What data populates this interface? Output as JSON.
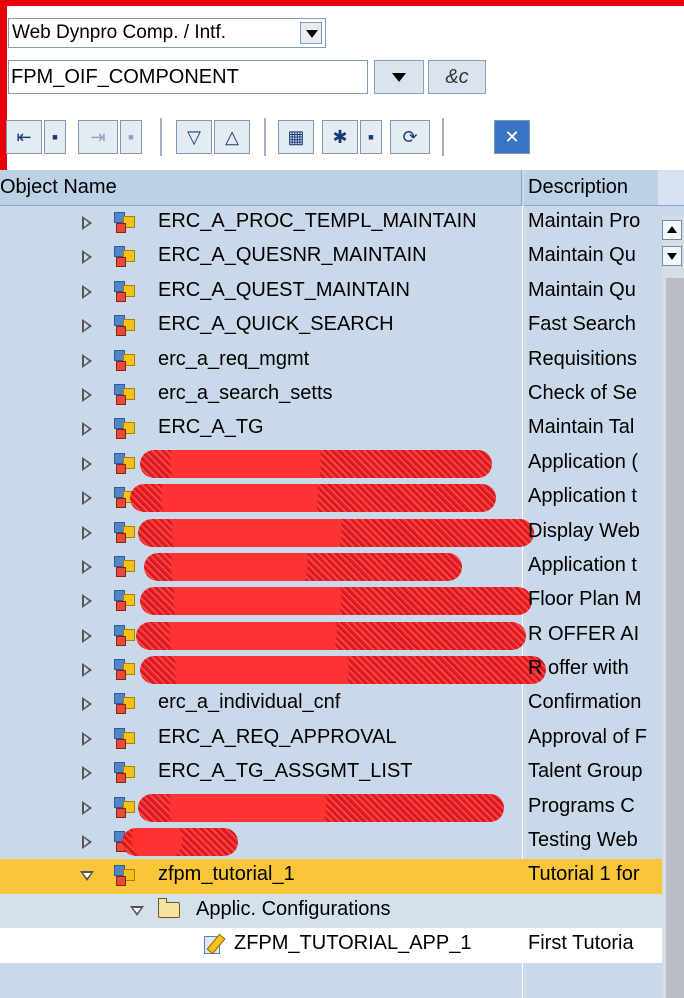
{
  "header": {
    "object_type_value": "Web Dynpro Comp. / Intf.",
    "object_name_value": "FPM_OIF_COMPONENT",
    "glasses_label": "&c"
  },
  "toolbar": {
    "buttons": [
      "previous-object",
      "next-object",
      "expand-all",
      "collapse-all",
      "hierarchy",
      "select",
      "refresh",
      "close"
    ]
  },
  "table": {
    "col_name": "Object Name",
    "col_desc": "Description",
    "rows": [
      {
        "name": "ERC_A_PROC_TEMPL_MAINTAIN",
        "desc": "Maintain Pro"
      },
      {
        "name": "ERC_A_QUESNR_MAINTAIN",
        "desc": "Maintain Qu"
      },
      {
        "name": "ERC_A_QUEST_MAINTAIN",
        "desc": "Maintain Qu"
      },
      {
        "name": "ERC_A_QUICK_SEARCH",
        "desc": "Fast Search"
      },
      {
        "name": "erc_a_req_mgmt",
        "desc": "Requisitions"
      },
      {
        "name": "erc_a_search_setts",
        "desc": "Check of Se"
      },
      {
        "name": "ERC_A_TG",
        "desc": "Maintain Tal"
      },
      {
        "name": "",
        "desc": "Application ("
      },
      {
        "name": "",
        "desc": "Application t"
      },
      {
        "name": "",
        "desc": "Display Web"
      },
      {
        "name": "",
        "desc": "Application t"
      },
      {
        "name": "",
        "desc": "Floor Plan M"
      },
      {
        "name": "",
        "desc": "R OFFER AI"
      },
      {
        "name": "",
        "desc": "R offer with"
      },
      {
        "name": "erc_a_individual_cnf",
        "desc": "Confirmation"
      },
      {
        "name": "ERC_A_REQ_APPROVAL",
        "desc": "Approval of F"
      },
      {
        "name": "ERC_A_TG_ASSGMT_LIST",
        "desc": "Talent Group"
      },
      {
        "name": "",
        "desc": "Programs C"
      },
      {
        "name": "",
        "desc": "Testing Web"
      },
      {
        "name": "zfpm_tutorial_1",
        "desc": "Tutorial 1 for"
      },
      {
        "name": "Applic. Configurations",
        "desc": ""
      },
      {
        "name": "ZFPM_TUTORIAL_APP_1",
        "desc": "First Tutoria"
      }
    ]
  }
}
